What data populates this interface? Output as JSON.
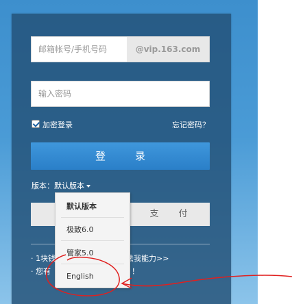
{
  "login_form": {
    "account_placeholder": "邮箱帐号/手机号码",
    "domain_suffix": "@vip.163.com",
    "password_placeholder": "输入密码",
    "encrypt_label": "加密登录",
    "encrypt_checked": true,
    "forgot_password": "忘记密码？",
    "login_button": "登　录",
    "version_label": "版本：默认版本",
    "pay_button": "支　付"
  },
  "notices": {
    "line1_visible": "· 1块钱",
    "line1_partial": "…法我能力>>",
    "line2_visible": "· 您有",
    "line2_partial": "！"
  },
  "version_menu": {
    "items": [
      "默认版本",
      "极致6.0",
      "管家5.0",
      "English"
    ],
    "selected": "默认版本"
  },
  "colors": {
    "background": "#4a9bd6",
    "panel": "#234f75",
    "login_button": "#2f86cf",
    "annotation": "#e0201f"
  }
}
